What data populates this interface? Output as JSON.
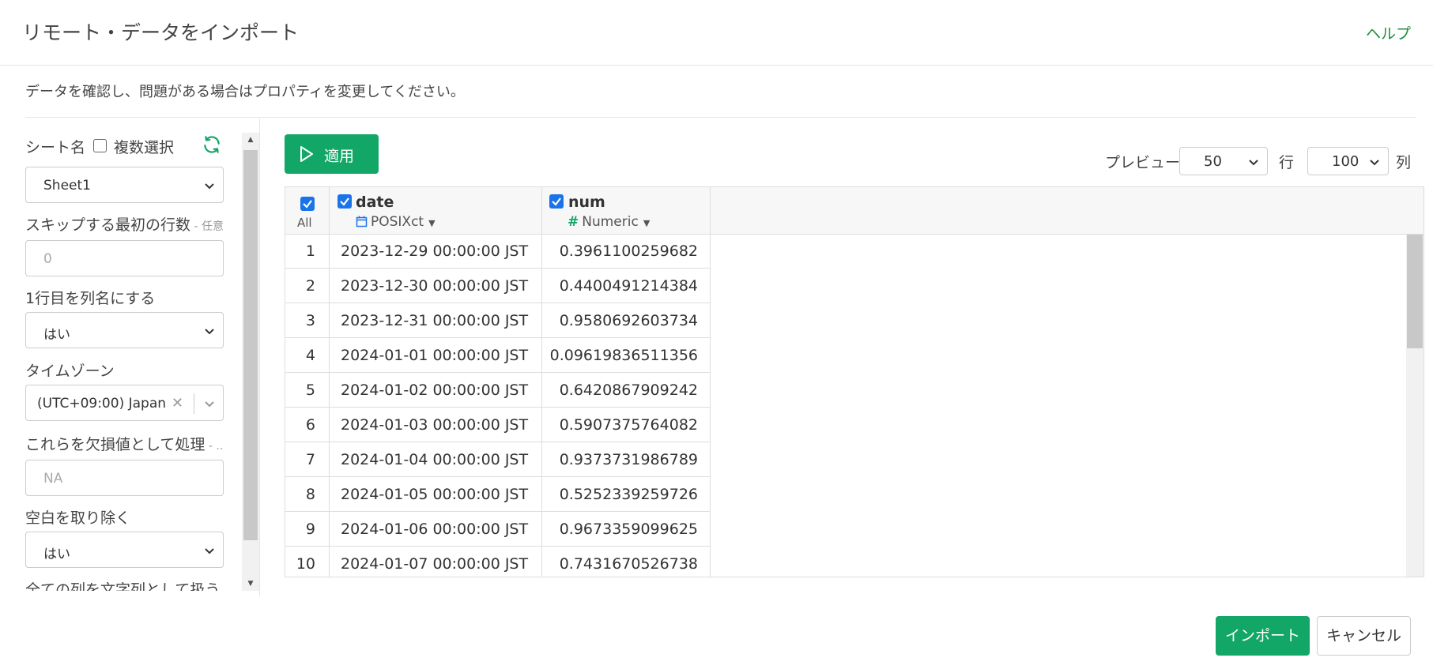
{
  "dialog": {
    "title": "リモート・データをインポート",
    "help_label": "ヘルプ",
    "instruction": "データを確認し、問題がある場合はプロパティを変更してください。"
  },
  "left_panel": {
    "sheet_label": "シート名",
    "multi_select_label": "複数選択",
    "multi_select_checked": false,
    "sheet_value": "Sheet1",
    "skip_rows_label": "スキップする最初の行数",
    "skip_rows_optional": " - 任意",
    "skip_rows_placeholder": "0",
    "header_row_label": "1行目を列名にする",
    "header_row_value": "はい",
    "timezone_label": "タイムゾーン",
    "timezone_value": "(UTC+09:00) Japan",
    "na_label": "これらを欠損値として処理",
    "na_optional": " - ...",
    "na_placeholder": "NA",
    "trim_label": "空白を取り除く",
    "trim_value": "はい",
    "all_as_string_label": "全ての列を文字列として扱う"
  },
  "toolbar": {
    "apply_label": "適用",
    "preview_label": "プレビュー:",
    "rows_value": "50",
    "rows_unit": "行",
    "cols_value": "100",
    "cols_unit": "列"
  },
  "grid": {
    "all_label": "All",
    "columns": [
      {
        "name": "date",
        "type": "POSIXct",
        "type_icon": "calendar-icon"
      },
      {
        "name": "num",
        "type": "Numeric",
        "type_icon": "hash-icon"
      }
    ],
    "rows": [
      {
        "idx": "1",
        "date": "2023-12-29 00:00:00 JST",
        "num": "0.3961100259682"
      },
      {
        "idx": "2",
        "date": "2023-12-30 00:00:00 JST",
        "num": "0.4400491214384"
      },
      {
        "idx": "3",
        "date": "2023-12-31 00:00:00 JST",
        "num": "0.9580692603734"
      },
      {
        "idx": "4",
        "date": "2024-01-01 00:00:00 JST",
        "num": "0.09619836511356"
      },
      {
        "idx": "5",
        "date": "2024-01-02 00:00:00 JST",
        "num": "0.6420867909242"
      },
      {
        "idx": "6",
        "date": "2024-01-03 00:00:00 JST",
        "num": "0.5907375764082"
      },
      {
        "idx": "7",
        "date": "2024-01-04 00:00:00 JST",
        "num": "0.9373731986789"
      },
      {
        "idx": "8",
        "date": "2024-01-05 00:00:00 JST",
        "num": "0.5252339259726"
      },
      {
        "idx": "9",
        "date": "2024-01-06 00:00:00 JST",
        "num": "0.9673359099625"
      },
      {
        "idx": "10",
        "date": "2024-01-07 00:00:00 JST",
        "num": "0.7431670526738"
      }
    ]
  },
  "footer": {
    "import_label": "インポート",
    "cancel_label": "キャンセル"
  },
  "colors": {
    "accent_green": "#12a766",
    "help_green": "#1e8e3e",
    "checkbox_blue": "#1a73e8"
  }
}
